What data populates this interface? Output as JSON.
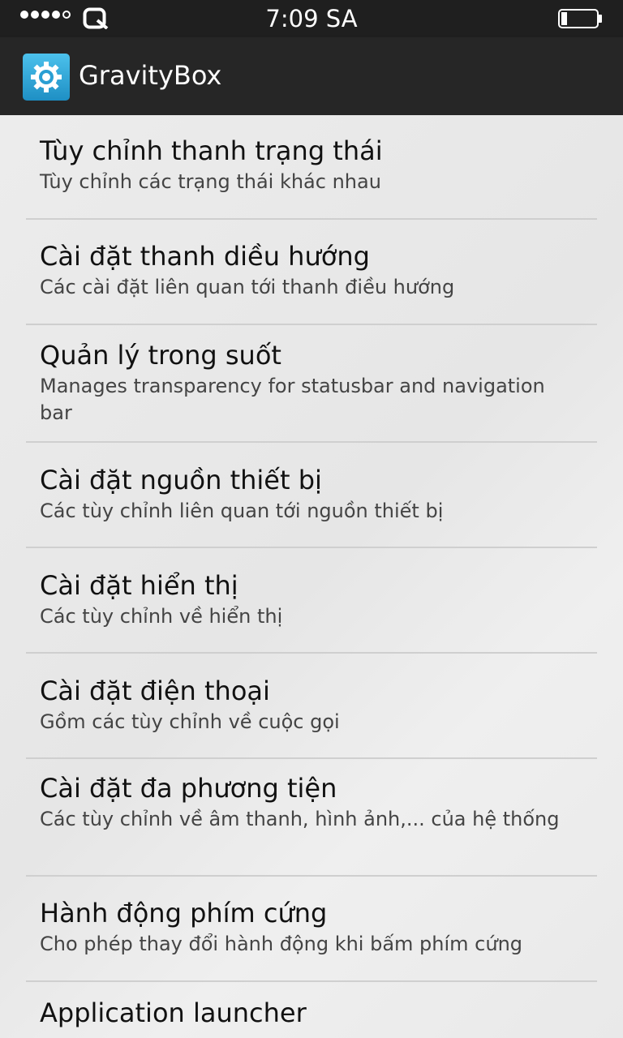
{
  "status_bar": {
    "time": "7:09 SA",
    "signal_icon": "signal-dots-icon",
    "carrier_icon": "carrier-logo-icon",
    "battery_icon": "battery-low-icon"
  },
  "action_bar": {
    "title": "GravityBox",
    "icon": "gear-icon",
    "icon_color": "#2aa6d6"
  },
  "items": [
    {
      "title": "Tùy chỉnh thanh trạng thái",
      "summary": "Tùy chỉnh các trạng thái khác nhau"
    },
    {
      "title": "Cài đặt thanh diều hướng",
      "summary": "Các cài đặt liên quan tới thanh điều hướng"
    },
    {
      "title": "Quản lý trong suốt",
      "summary": "Manages transparency for statusbar and navigation bar"
    },
    {
      "title": "Cài đặt nguồn thiết bị",
      "summary": "Các tùy chỉnh liên quan tới nguồn thiết bị"
    },
    {
      "title": "Cài đặt hiển thị",
      "summary": "Các tùy chỉnh về hiển thị"
    },
    {
      "title": "Cài đặt điện thoại",
      "summary": "Gồm các tùy chỉnh về cuộc gọi"
    },
    {
      "title": "Cài đặt đa phương tiện",
      "summary": "Các tùy chỉnh về âm thanh, hình ảnh,... của hệ thống"
    },
    {
      "title": "Hành động phím cứng",
      "summary": "Cho phép thay đổi hành động khi bấm phím cứng"
    },
    {
      "title": "Application launcher",
      "summary": ""
    }
  ]
}
